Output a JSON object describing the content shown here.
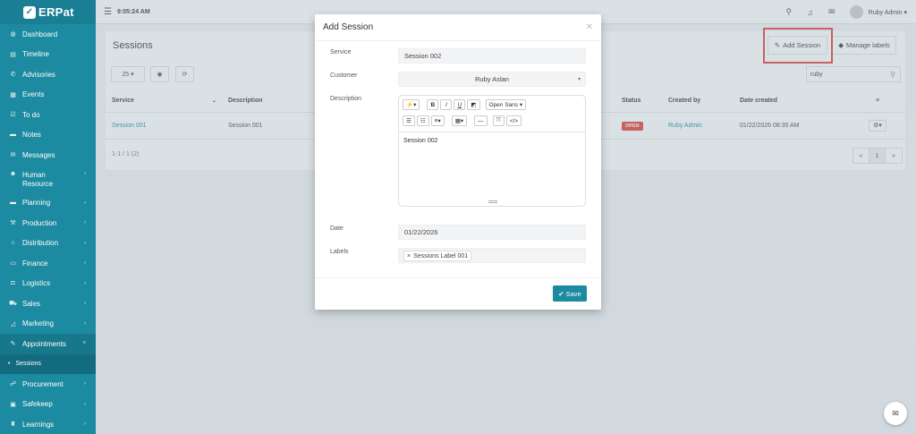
{
  "app": {
    "logo_mark": "✓",
    "logo_text": "ERPat"
  },
  "topbar": {
    "time": "9:05:24 AM",
    "user": "Ruby Admin ▾"
  },
  "sidebar": {
    "items": [
      {
        "label": "Dashboard",
        "icon": "dashboard-icon",
        "glyph": "◍"
      },
      {
        "label": "Timeline",
        "icon": "timeline-icon",
        "glyph": "▤"
      },
      {
        "label": "Advisories",
        "icon": "megaphone-icon",
        "glyph": "✆"
      },
      {
        "label": "Events",
        "icon": "calendar-icon",
        "glyph": "▦"
      },
      {
        "label": "To do",
        "icon": "checkbox-icon",
        "glyph": "☑"
      },
      {
        "label": "Notes",
        "icon": "note-icon",
        "glyph": "▬"
      },
      {
        "label": "Messages",
        "icon": "envelope-icon",
        "glyph": "✉"
      },
      {
        "label": "Human Resource",
        "icon": "users-icon",
        "glyph": "☻"
      },
      {
        "label": "Planning",
        "icon": "briefcase-icon",
        "glyph": "▬"
      },
      {
        "label": "Production",
        "icon": "wrench-icon",
        "glyph": "⚒"
      },
      {
        "label": "Distribution",
        "icon": "bank-icon",
        "glyph": "⌂"
      },
      {
        "label": "Finance",
        "icon": "money-icon",
        "glyph": "▭"
      },
      {
        "label": "Logistics",
        "icon": "truck-icon",
        "glyph": "◘"
      },
      {
        "label": "Sales",
        "icon": "cart-icon",
        "glyph": "⛟"
      },
      {
        "label": "Marketing",
        "icon": "chart-icon",
        "glyph": "◿"
      },
      {
        "label": "Appointments",
        "icon": "edit-icon",
        "glyph": "✎"
      },
      {
        "label": "Sessions",
        "icon": "dot-icon",
        "glyph": "•"
      },
      {
        "label": "Procurement",
        "icon": "handshake-icon",
        "glyph": "☍"
      },
      {
        "label": "Safekeep",
        "icon": "archive-icon",
        "glyph": "▣"
      },
      {
        "label": "Learnings",
        "icon": "graduation-icon",
        "glyph": "♜"
      }
    ]
  },
  "page": {
    "title": "Sessions",
    "add_session": "Add Session",
    "manage_labels": "Manage labels",
    "page_size": "25",
    "search_value": "ruby",
    "columns": [
      "Service",
      "Description",
      "Status",
      "Created by",
      "Date created"
    ],
    "rows": [
      {
        "service": "Session 001",
        "description": "Session 001",
        "status": "OPEN",
        "created_by": "Ruby Admin",
        "date_created": "01/22/2026 08:35 AM"
      }
    ],
    "count_text": "1-1 / 1 (2)",
    "page_current": "1"
  },
  "modal": {
    "title": "Add Session",
    "service_label": "Service",
    "service_value": "Session 002",
    "customer_label": "Customer",
    "customer_value": "Ruby Aslan",
    "description_label": "Description",
    "font_name": "Open Sans ▾",
    "editor_text": "Session 002",
    "date_label": "Date",
    "date_value": "01/22/2026",
    "labels_label": "Labels",
    "label_tag": "Sessions Label 001",
    "save": "Save"
  }
}
